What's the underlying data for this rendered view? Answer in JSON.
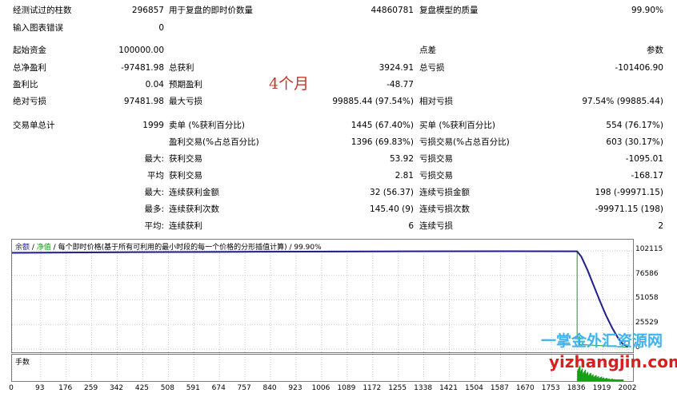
{
  "stats": {
    "row1": [
      {
        "label": "经测试过的柱数",
        "value": "296857"
      },
      {
        "label": "用于复盘的即时价数量",
        "value": "44860781"
      },
      {
        "label": "复盘模型的质量",
        "value": "99.90%"
      }
    ],
    "input_errors": {
      "label": "输入图表错误",
      "value": "0"
    },
    "initial_deposit": {
      "label": "起始资金",
      "value": "100000.00"
    },
    "spread": {
      "label": "点差",
      "value": "参数"
    },
    "net_profit": {
      "label": "总净盈利",
      "value": "-97481.98"
    },
    "gross_profit": {
      "label": "总获利",
      "value": "3924.91"
    },
    "gross_loss": {
      "label": "总亏损",
      "value": "-101406.90"
    },
    "profit_factor": {
      "label": "盈利比",
      "value": "0.04"
    },
    "expected_payoff": {
      "label": "预期盈利",
      "value": "-48.77"
    },
    "abs_drawdown": {
      "label": "绝对亏损",
      "value": "97481.98"
    },
    "max_drawdown": {
      "label": "最大亏损",
      "value": "99885.44 (97.54%)"
    },
    "rel_drawdown": {
      "label": "相对亏损",
      "value": "97.54% (99885.44)"
    },
    "total_trades": {
      "label": "交易单总计",
      "value": "1999"
    },
    "short_positions": {
      "label": "卖单 (%获利百分比)",
      "value": "1445 (67.40%)"
    },
    "long_positions": {
      "label": "买单 (%获利百分比)",
      "value": "554 (76.17%)"
    },
    "profit_trades": {
      "label": "盈利交易(%占总百分比)",
      "value": "1396 (69.83%)"
    },
    "loss_trades": {
      "label": "亏损交易(%占总百分比)",
      "value": "603 (30.17%)"
    },
    "largest_profit": {
      "prefix": "最大:",
      "label": "获利交易",
      "value": "53.92"
    },
    "largest_loss": {
      "label": "亏损交易",
      "value": "-1095.01"
    },
    "average_profit": {
      "prefix": "平均",
      "label": "获利交易",
      "value": "2.81"
    },
    "average_loss": {
      "label": "亏损交易",
      "value": "-168.17"
    },
    "max_cons_wins_money": {
      "prefix": "最大:",
      "label": "连续获利金额",
      "value": "32 (56.37)"
    },
    "max_cons_losses_money": {
      "label": "连续亏损金额",
      "value": "198 (-99971.15)"
    },
    "max_cons_profit_count": {
      "prefix": "最多:",
      "label": "连续获利次数",
      "value": "145.40 (9)"
    },
    "max_cons_loss_count": {
      "label": "连续亏损次数",
      "value": "-99971.15 (198)"
    },
    "avg_cons_wins": {
      "prefix": "平均:",
      "label": "连续获利",
      "value": "6"
    },
    "avg_cons_losses": {
      "label": "连续亏损",
      "value": "2"
    }
  },
  "annotation": "4个月",
  "chart": {
    "caption_balance": "余额",
    "caption_sep1": " / ",
    "caption_equity": "净值",
    "caption_sep2": " / ",
    "caption_text": "每个即时价格(基于所有可利用的最小时段的每一个价格的分形插值计算) / 99.90%",
    "lot_caption": "手数",
    "colors": {
      "balance": "#1e1e8c",
      "equity": "#16a016",
      "grid": "#c8c8c8"
    }
  },
  "chart_data": {
    "type": "line",
    "title": "",
    "ylim": [
      0,
      102115
    ],
    "yticks": [
      "102115",
      "76586",
      "51058",
      "25529",
      "0"
    ],
    "xlim": [
      0,
      2002
    ],
    "xticks": [
      "0",
      "93",
      "176",
      "259",
      "342",
      "425",
      "508",
      "591",
      "674",
      "757",
      "840",
      "923",
      "1006",
      "1089",
      "1172",
      "1255",
      "1338",
      "1421",
      "1504",
      "1587",
      "1670",
      "1753",
      "1836",
      "1919",
      "2002"
    ],
    "grid": true,
    "series": [
      {
        "name": "余额",
        "x": [
          0,
          400,
          800,
          1200,
          1600,
          1836,
          1850,
          1870,
          1890,
          1910,
          1930,
          1950,
          1970,
          1985,
          2002
        ],
        "values": [
          100000,
          100800,
          101200,
          101500,
          101700,
          101600,
          96000,
          82000,
          66000,
          50000,
          35000,
          22000,
          11000,
          5000,
          2500
        ]
      },
      {
        "name": "净值",
        "x": [
          0,
          1600,
          1836,
          1836,
          1845,
          1845,
          1860,
          2002
        ],
        "values": [
          100000,
          101700,
          101600,
          12500,
          12500,
          4500,
          4500,
          2000
        ]
      }
    ]
  },
  "watermark": {
    "line1": "一掌金外汇资源网",
    "line2": "yizhangjin.com"
  }
}
